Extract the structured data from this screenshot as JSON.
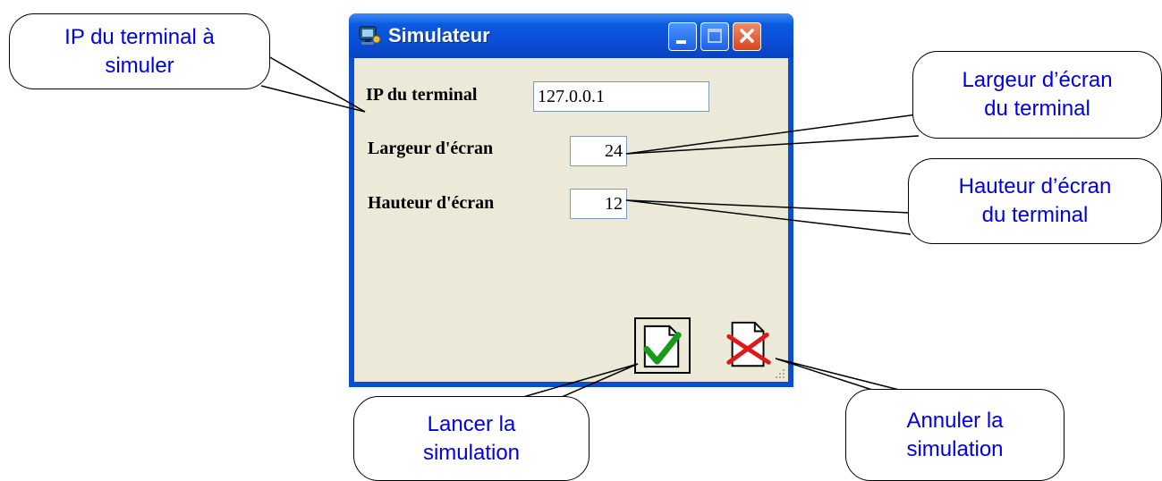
{
  "window": {
    "title": "Simulateur",
    "buttons": [
      "minimize",
      "maximize",
      "close"
    ],
    "icon": "simulator-app-icon"
  },
  "form": {
    "ip": {
      "label": "IP du terminal",
      "value": "127.0.0.1"
    },
    "width": {
      "label": "Largeur d'écran",
      "value": "24"
    },
    "height": {
      "label": "Hauteur d'écran",
      "value": "12"
    }
  },
  "actions": {
    "launch": {
      "icon": "document-checkmark-icon"
    },
    "cancel": {
      "icon": "document-cross-icon"
    }
  },
  "callouts": {
    "ip": "IP du terminal à\nsimuler",
    "width": "Largeur d’écran\ndu terminal",
    "height": "Hauteur d’écran\ndu terminal",
    "launch": "Lancer la\nsimulation",
    "cancel": "Annuler la\nsimulation"
  },
  "colors": {
    "callout_text": "#0000e6",
    "titlebar": "#0a4fd8",
    "close_button": "#d8461d",
    "window_body": "#ece9d8",
    "check": "#1a9a1a",
    "cross": "#e01818"
  }
}
